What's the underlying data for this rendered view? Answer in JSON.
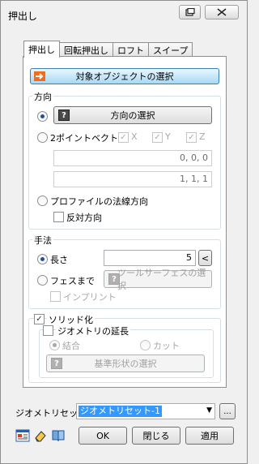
{
  "window": {
    "title": "押出し"
  },
  "tabs": [
    {
      "label": "押出し"
    },
    {
      "label": "回転押出し"
    },
    {
      "label": "ロフト"
    },
    {
      "label": "スイープ"
    }
  ],
  "select_object_button": "対象オブジェクトの選択",
  "direction": {
    "group_label": "方向",
    "select_direction_button": "方向の選択",
    "two_point_label": "2ポイントベクトル",
    "x_label": "X",
    "y_label": "Y",
    "z_label": "Z",
    "point1_value": "0, 0, 0",
    "point2_value": "1, 1, 1",
    "profile_normal_label": "プロファイルの法線方向",
    "reverse_label": "反対方向"
  },
  "method": {
    "group_label": "手法",
    "length_label": "長さ",
    "length_value": "5",
    "length_spin": "<",
    "to_face_label": "フェスまで",
    "tool_surface_button": "ツールサーフェスの選択",
    "imprint_label": "インプリント"
  },
  "solidify": {
    "label": "ソリッド化",
    "extend_geometry_label": "ジオメトリの延長",
    "join_label": "結合",
    "cut_label": "カット",
    "base_shape_button": "基準形状の選択"
  },
  "geometry_set": {
    "label": "ジオメトリセット",
    "selected": "ジオメトリセット-1",
    "browse": "..."
  },
  "buttons": {
    "ok": "OK",
    "close": "閉じる",
    "apply": "適用"
  },
  "icons": {
    "orange_arrow": "arrow-right-icon",
    "help": "?",
    "title_restore": "restore-icon",
    "title_close": "close-icon"
  }
}
